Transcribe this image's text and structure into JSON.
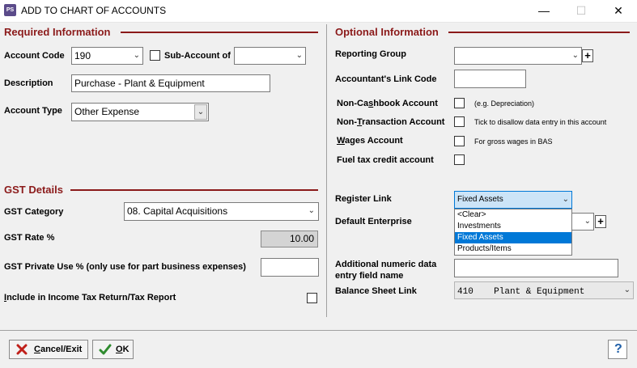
{
  "window": {
    "app_icon": "PS",
    "title": "ADD TO CHART OF ACCOUNTS",
    "minimize": "—",
    "maximize": "☐",
    "close": "✕"
  },
  "required": {
    "title": "Required Information",
    "account_code_label": "Account Code",
    "account_code_value": "190",
    "sub_account_label": "Sub-Account of",
    "sub_account_value": "",
    "description_label": "Description",
    "description_value": "Purchase - Plant & Equipment",
    "account_type_label": "Account Type",
    "account_type_value": "Other Expense"
  },
  "gst": {
    "title": "GST Details",
    "category_label": "GST Category",
    "category_value": "08. Capital Acquisitions",
    "rate_label": "GST Rate %",
    "rate_value": "10.00",
    "private_use_label": "GST Private Use % (only use for part business expenses)",
    "private_use_value": "",
    "income_tax_label_pre": "",
    "income_tax_label_u": "I",
    "income_tax_label_post": "nclude in Income Tax Return/Tax Report"
  },
  "optional": {
    "title": "Optional Information",
    "reporting_group_label": "Reporting Group",
    "reporting_group_value": "",
    "link_code_label": "Accountant's Link Code",
    "link_code_value": "",
    "non_cashbook_pre": "Non-Ca",
    "non_cashbook_u": "s",
    "non_cashbook_post": "hbook Account",
    "non_cashbook_hint": "(e.g. Depreciation)",
    "non_transaction_pre": "Non-",
    "non_transaction_u": "T",
    "non_transaction_post": "ransaction Account",
    "non_transaction_hint": "Tick to disallow data entry in this account",
    "wages_pre": "",
    "wages_u": "W",
    "wages_post": "ages Account",
    "wages_hint": "For gross wages in BAS",
    "fuel_label": "Fuel tax credit account",
    "register_link_label": "Register Link",
    "register_link_value": "Fixed Assets",
    "register_link_options": [
      "<Clear>",
      "Investments",
      "Fixed Assets",
      "Products/Items"
    ],
    "default_enterprise_label": "Default Enterprise",
    "additional_label_1": "Additional numeric data",
    "additional_label_2": "entry field name",
    "additional_value": "",
    "balance_sheet_label": "Balance Sheet Link",
    "balance_sheet_code": "410",
    "balance_sheet_name": "Plant & Equipment"
  },
  "buttons": {
    "cancel_pre": "",
    "cancel_u": "C",
    "cancel_post": "ancel/Exit",
    "ok_pre": "",
    "ok_u": "O",
    "ok_post": "K",
    "help": "?"
  },
  "colors": {
    "section_accent": "#8b1a1a",
    "selection": "#0078d7",
    "register_link_bg": "#cce4f7"
  }
}
